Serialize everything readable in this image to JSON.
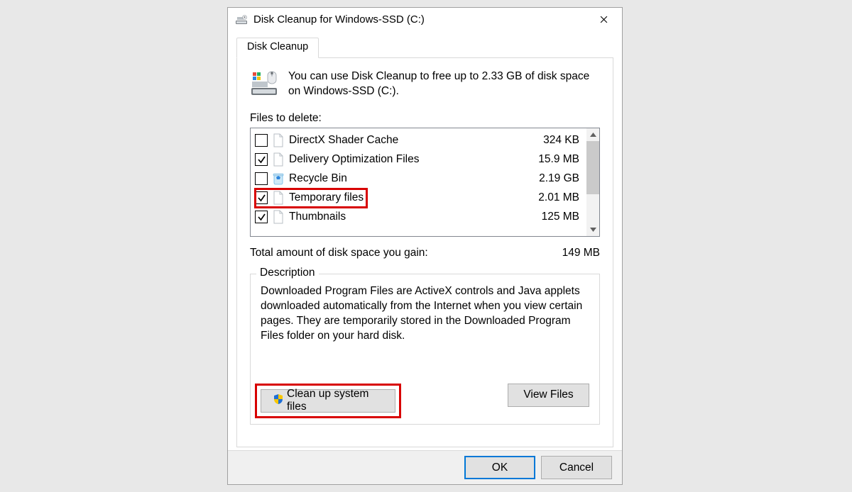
{
  "title": "Disk Cleanup for Windows-SSD (C:)",
  "tab_label": "Disk Cleanup",
  "intro_text": "You can use Disk Cleanup to free up to 2.33 GB of disk space on Windows-SSD (C:).",
  "files_label": "Files to delete:",
  "files": [
    {
      "name": "DirectX Shader Cache",
      "size": "324 KB",
      "checked": false,
      "icon": "page",
      "highlight": false
    },
    {
      "name": "Delivery Optimization Files",
      "size": "15.9 MB",
      "checked": true,
      "icon": "page",
      "highlight": false
    },
    {
      "name": "Recycle Bin",
      "size": "2.19 GB",
      "checked": false,
      "icon": "recycle",
      "highlight": false
    },
    {
      "name": "Temporary files",
      "size": "2.01 MB",
      "checked": true,
      "icon": "page",
      "highlight": true
    },
    {
      "name": "Thumbnails",
      "size": "125 MB",
      "checked": true,
      "icon": "page",
      "highlight": false
    }
  ],
  "total_label": "Total amount of disk space you gain:",
  "total_value": "149 MB",
  "description_legend": "Description",
  "description_text": "Downloaded Program Files are ActiveX controls and Java applets downloaded automatically from the Internet when you view certain pages. They are temporarily stored in the Downloaded Program Files folder on your hard disk.",
  "cleanup_label": "Clean up system files",
  "viewfiles_label": "View Files",
  "ok_label": "OK",
  "cancel_label": "Cancel"
}
